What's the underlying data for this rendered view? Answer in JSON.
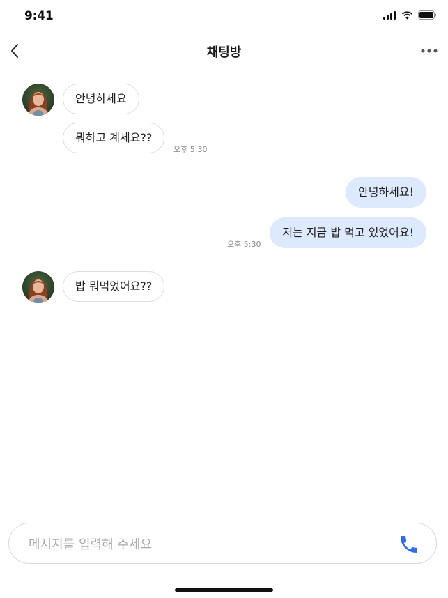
{
  "status_bar": {
    "time": "9:41"
  },
  "header": {
    "title": "채팅방"
  },
  "messages": [
    {
      "direction": "in",
      "text": "안녕하세요"
    },
    {
      "direction": "in",
      "text": "뭐하고 계세요??",
      "time": "오후 5:30"
    },
    {
      "direction": "out",
      "text": "안녕하세요!"
    },
    {
      "direction": "out",
      "text": "저는 지금 밥 먹고 있었어요!",
      "time": "오후 5:30"
    },
    {
      "direction": "in",
      "text": "밥 뭐먹었어요??"
    }
  ],
  "input": {
    "placeholder": "메시지를 입력해 주세요",
    "value": ""
  },
  "colors": {
    "accent": "#2f6fed",
    "outgoing_bubble": "#dde9fd",
    "incoming_border": "#dedede"
  },
  "icons": {
    "back": "chevron-left-icon",
    "more": "more-horizontal-icon",
    "call": "phone-icon",
    "signal": "cellular-signal-icon",
    "wifi": "wifi-icon",
    "battery": "battery-icon"
  }
}
